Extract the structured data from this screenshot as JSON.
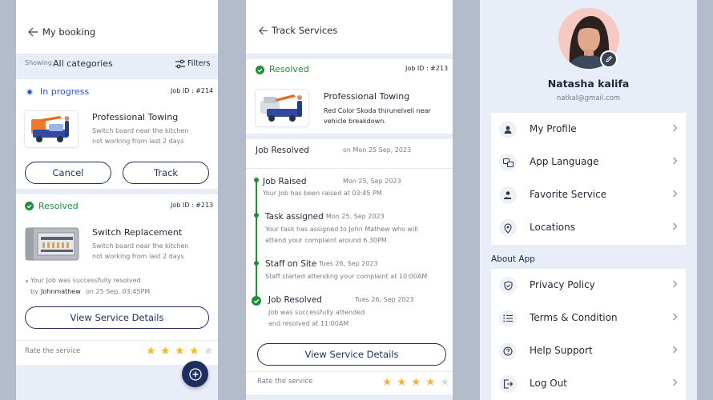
{
  "booking": {
    "title": "My booking",
    "showing_label": "Showing",
    "category": "All categories",
    "filters_label": "Filters",
    "card1": {
      "status": "In progress",
      "job_id": "Job ID : #214",
      "service_title": "Professional Towing",
      "desc_line1": "Switch board near the kitchen",
      "desc_line2": "not working from last 2 days",
      "cancel_label": "Cancel",
      "track_label": "Track"
    },
    "card2": {
      "status": "Resolved",
      "job_id": "Job ID : #213",
      "service_title": "Switch Replacement",
      "desc_line1": "Switch board near the kitchen",
      "desc_line2": "not working from last 2 days",
      "resolved_line1": "Your Job was successfully resolved",
      "by_label": "by",
      "resolver": "Johnmathew",
      "resolved_on": "on 25 Sep, 03:45PM",
      "view_label": "View Service Details"
    },
    "rate_label": "Rate the service",
    "rating": 4,
    "rating_max": 5
  },
  "track": {
    "title": "Track Services",
    "status": "Resolved",
    "job_id": "Job ID : #213",
    "service_title": "Professional Towing",
    "desc_line1": "Red Color Skoda thirunelveli near",
    "desc_line2": "vehicle breakdown.",
    "resolved_heading": "Job Resolved",
    "resolved_date": "on Mon 25 Sep, 2023",
    "timeline": [
      {
        "title": "Job Raised",
        "date": "Mon 25, Sep 2023",
        "line1": "Your Job has been raised at 03:45 PM",
        "line2": ""
      },
      {
        "title": "Task assigned",
        "date": "Mon 25, Sep 2023",
        "line1": "Your task has assigned to John Mathew who will",
        "line2": "attend your complaint around 6.30PM"
      },
      {
        "title": "Staff on Site",
        "date": "Tues 26, Sep 2023",
        "line1": "Staff started attending your complaint at 10:00AM",
        "line2": ""
      },
      {
        "title": "Job Resolved",
        "date": "Tues 26, Sep 2023",
        "line1": "Job was successfully attended",
        "line2": "and resolved at 11:00AM"
      }
    ],
    "view_label": "View Service Details",
    "rate_label": "Rate the service",
    "rating": 4,
    "rating_max": 5
  },
  "profile": {
    "name": "Natasha kalifa",
    "email": "natkal@gmail.com",
    "menu": [
      {
        "label": "My Profile",
        "icon": "user-icon"
      },
      {
        "label": "App Language",
        "icon": "language-icon"
      },
      {
        "label": "Favorite Service",
        "icon": "favorite-hand-icon"
      },
      {
        "label": "Locations",
        "icon": "location-pin-icon"
      }
    ],
    "about_heading": "About App",
    "about_menu": [
      {
        "label": "Privacy Policy",
        "icon": "shield-icon"
      },
      {
        "label": "Terms & Condition",
        "icon": "list-icon"
      },
      {
        "label": "Help Support",
        "icon": "help-icon"
      },
      {
        "label": "Log Out",
        "icon": "logout-icon"
      }
    ]
  },
  "colors": {
    "accent": "#1e2e5e",
    "in_progress": "#2c51c9",
    "resolved": "#1d8f3a",
    "star": "#f6b733",
    "band": "#e8edf8",
    "background": "#b4bccc"
  }
}
